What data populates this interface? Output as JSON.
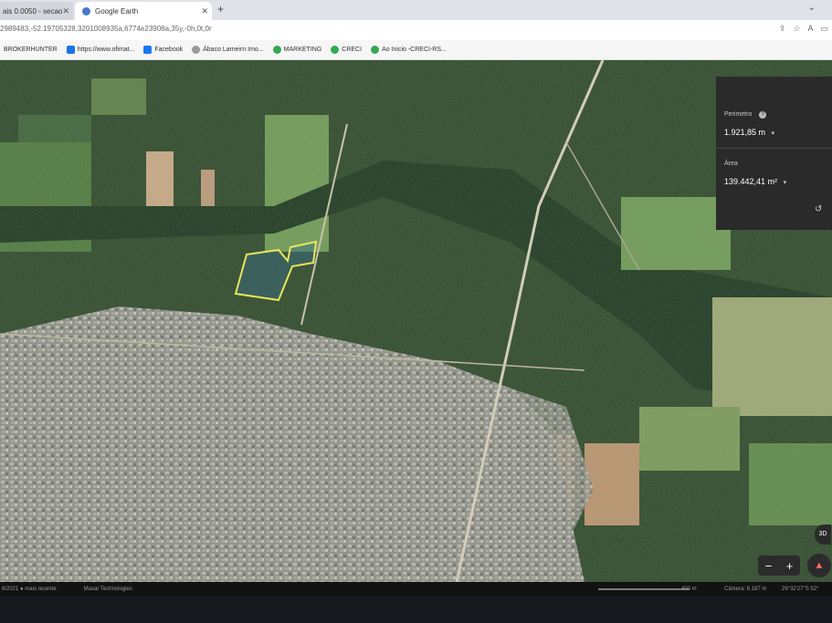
{
  "browser": {
    "tabs": [
      {
        "label": "ais 0.0050 - secao",
        "active": false
      },
      {
        "label": "Google Earth",
        "active": true
      }
    ],
    "url": "2989483,-52.19705328,3201008935a,6774e23908a,35y,-0h,0t,0r",
    "bookmarks": [
      {
        "label": "BROKERHUNTER",
        "color": "#777777"
      },
      {
        "label": "https://www.ofimat...",
        "color": "#1a73e8"
      },
      {
        "label": "Facebook",
        "color": "#1877f2"
      },
      {
        "label": "Ábaco Lameirn Imo...",
        "color": "#999999"
      },
      {
        "label": "MARKETING",
        "color": "#34a853"
      },
      {
        "label": "CRECI",
        "color": "#34a853"
      },
      {
        "label": "Ao Inicio -CRECI-RS...",
        "color": "#34a853"
      }
    ]
  },
  "measure_panel": {
    "perimeter_label": "Perimetro",
    "perimeter_value": "1.921,85 m",
    "area_label": "Área",
    "area_value": "139.442,41 m²"
  },
  "map_controls": {
    "view_3d_label": "3D",
    "zoom_in": "+",
    "zoom_out": "−"
  },
  "status_bar": {
    "imagery_date": "6/2021 ● mais recente",
    "credits": "Maxar Technologies",
    "scale_label": "400 m",
    "camera": "Câmera: 6.187 m",
    "coordinates": "29°32'27\"S 52°"
  },
  "colors": {
    "polygon_outline": "#e8e65a",
    "panel_bg": "#2a2a2a"
  }
}
